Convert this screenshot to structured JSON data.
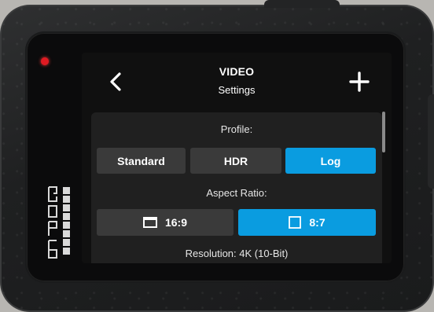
{
  "header": {
    "title": "VIDEO",
    "subtitle": "Settings",
    "back_icon": "chevron-left-icon",
    "add_icon": "plus-icon"
  },
  "profile": {
    "label": "Profile:",
    "options": [
      "Standard",
      "HDR",
      "Log"
    ],
    "selected": "Log"
  },
  "aspect_ratio": {
    "label": "Aspect Ratio:",
    "options": [
      {
        "label": "16:9",
        "icon": "widescreen-frame-icon"
      },
      {
        "label": "8:7",
        "icon": "square-frame-icon"
      }
    ],
    "selected": "8:7"
  },
  "resolution": {
    "label": "Resolution: 4K (10-Bit)"
  },
  "colors": {
    "accent": "#0a9ce0",
    "recording_light": "#e01a22"
  }
}
